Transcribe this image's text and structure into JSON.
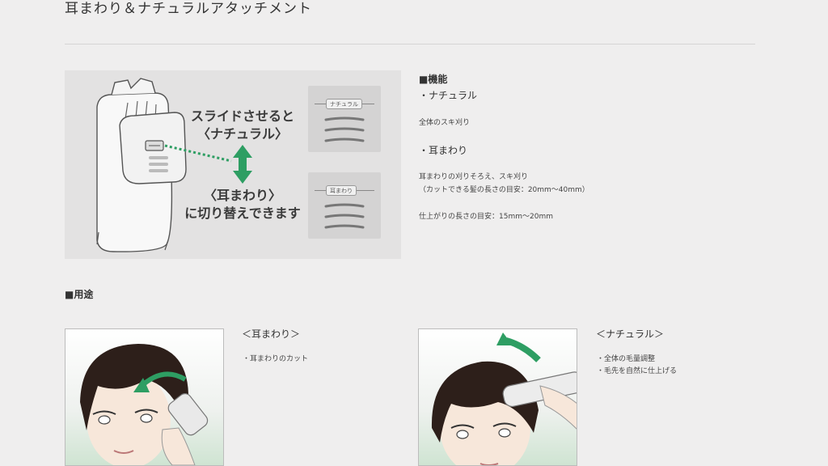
{
  "page": {
    "title": "耳まわり＆ナチュラルアタッチメント"
  },
  "figure": {
    "slide_line1": "スライドさせると",
    "slide_line2": "〈ナチュラル〉",
    "swap_line1": "〈耳まわり〉",
    "swap_line2": "に切り替えできます",
    "natural_tag": "ナチュラル",
    "ear_tag": "耳まわり",
    "arrow_color": "#2e9e63"
  },
  "functions": {
    "heading": "■機能",
    "natural_title": "・ナチュラル",
    "natural_desc": "全体のスキ刈り",
    "ear_title": "・耳まわり",
    "ear_desc": "耳まわりの刈りそろえ、スキ刈り",
    "ear_detail": "（カットできる髪の長さの目安：20mm〜40mm）",
    "finish_length": "仕上がりの長さの目安：15mm〜20mm"
  },
  "uses": {
    "heading": "■用途",
    "ear": {
      "label": "＜耳まわり＞",
      "bullets": [
        "・耳まわりのカット"
      ]
    },
    "natural": {
      "label": "＜ナチュラル＞",
      "bullets": [
        "・全体の毛量調整",
        "・毛先を自然に仕上げる"
      ]
    }
  }
}
